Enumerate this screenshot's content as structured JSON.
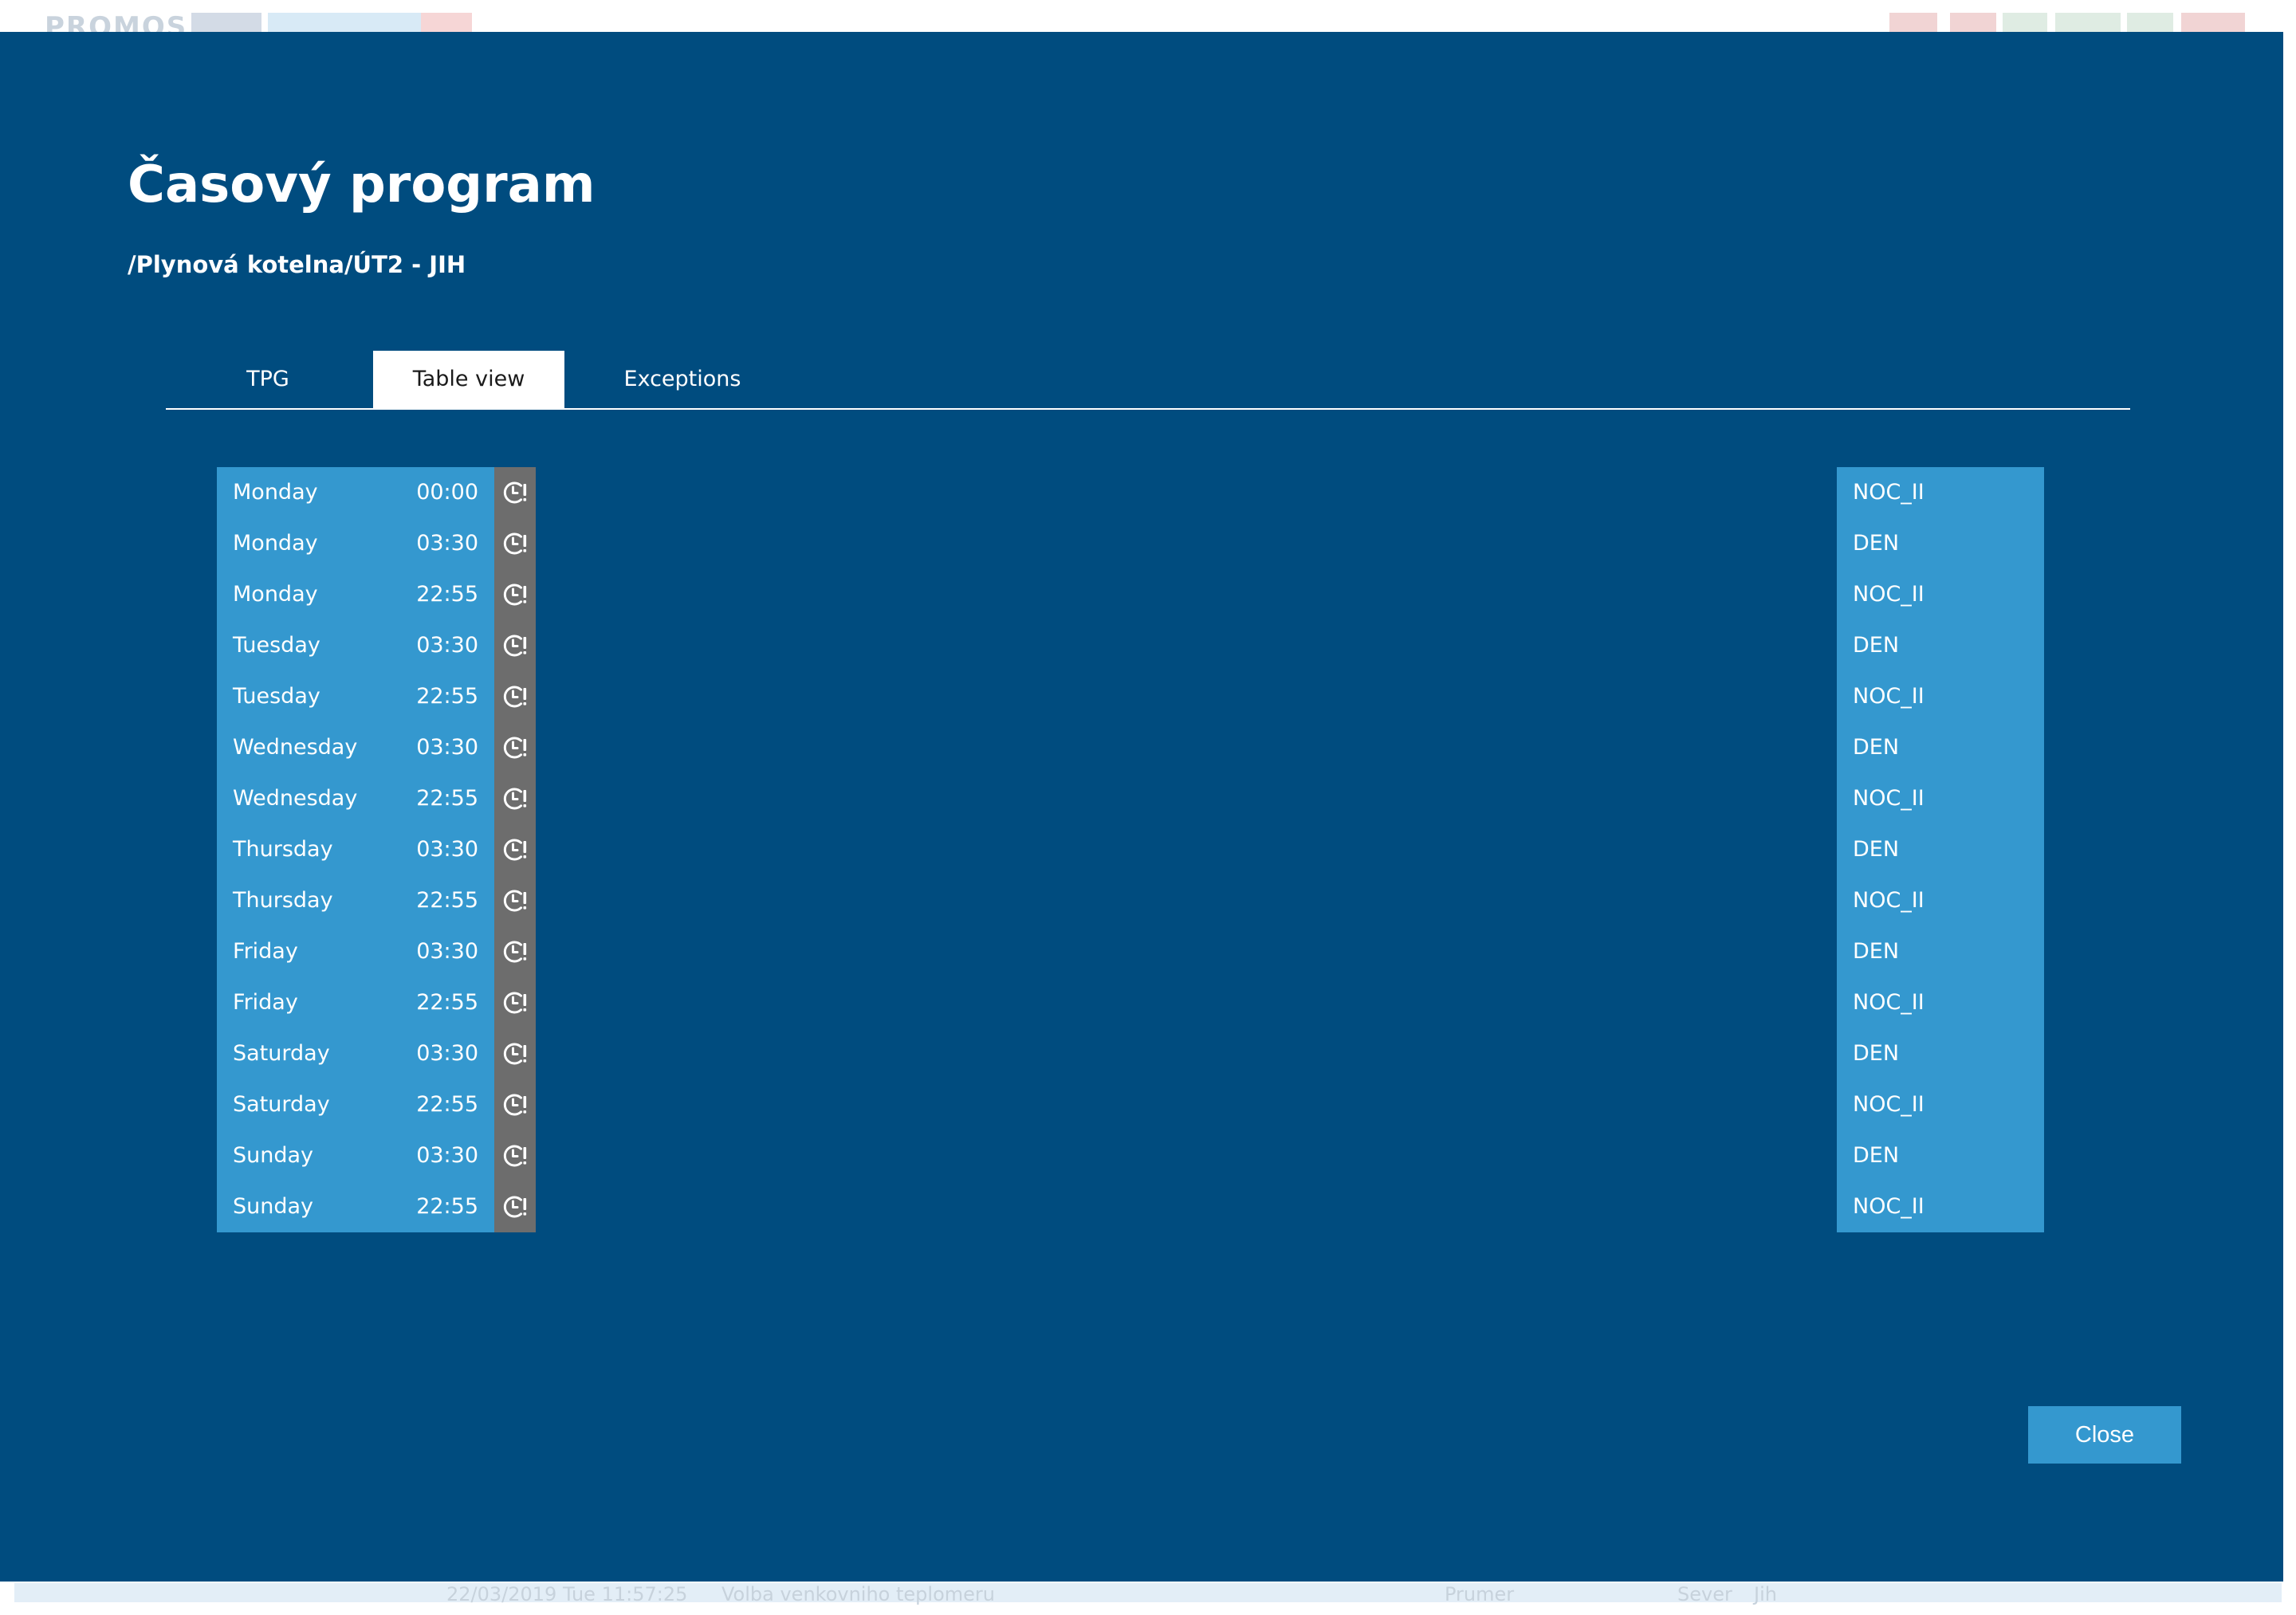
{
  "background_app": {
    "logo_text": "PROMOS",
    "status_line": "22/03/2019 Tue 11:57:25",
    "status_message": "Volba venkovniho teplomeru",
    "status_col": "Prumer",
    "status_option_north": "Sever",
    "status_option_south": "Jih"
  },
  "modal": {
    "title": "Časový program",
    "path": "/Plynová kotelna/ÚT2 - JIH",
    "tabs": [
      {
        "label": "TPG",
        "active": false
      },
      {
        "label": "Table view",
        "active": true
      },
      {
        "label": "Exceptions",
        "active": false
      }
    ],
    "schedule": [
      {
        "day": "Monday",
        "time": "00:00",
        "icon": "clock-exclaim-icon",
        "state": "NOC_II"
      },
      {
        "day": "Monday",
        "time": "03:30",
        "icon": "clock-exclaim-icon",
        "state": "DEN"
      },
      {
        "day": "Monday",
        "time": "22:55",
        "icon": "clock-exclaim-icon",
        "state": "NOC_II"
      },
      {
        "day": "Tuesday",
        "time": "03:30",
        "icon": "clock-exclaim-icon",
        "state": "DEN"
      },
      {
        "day": "Tuesday",
        "time": "22:55",
        "icon": "clock-exclaim-icon",
        "state": "NOC_II"
      },
      {
        "day": "Wednesday",
        "time": "03:30",
        "icon": "clock-exclaim-icon",
        "state": "DEN"
      },
      {
        "day": "Wednesday",
        "time": "22:55",
        "icon": "clock-exclaim-icon",
        "state": "NOC_II"
      },
      {
        "day": "Thursday",
        "time": "03:30",
        "icon": "clock-exclaim-icon",
        "state": "DEN"
      },
      {
        "day": "Thursday",
        "time": "22:55",
        "icon": "clock-exclaim-icon",
        "state": "NOC_II"
      },
      {
        "day": "Friday",
        "time": "03:30",
        "icon": "clock-exclaim-icon",
        "state": "DEN"
      },
      {
        "day": "Friday",
        "time": "22:55",
        "icon": "clock-exclaim-icon",
        "state": "NOC_II"
      },
      {
        "day": "Saturday",
        "time": "03:30",
        "icon": "clock-exclaim-icon",
        "state": "DEN"
      },
      {
        "day": "Saturday",
        "time": "22:55",
        "icon": "clock-exclaim-icon",
        "state": "NOC_II"
      },
      {
        "day": "Sunday",
        "time": "03:30",
        "icon": "clock-exclaim-icon",
        "state": "DEN"
      },
      {
        "day": "Sunday",
        "time": "22:55",
        "icon": "clock-exclaim-icon",
        "state": "NOC_II"
      }
    ],
    "close_label": "Close"
  },
  "colors": {
    "modal_bg": "#004c7f",
    "cell_bg": "#3498cf",
    "icon_cell_bg": "#6d6d6d",
    "text": "#ffffff"
  }
}
